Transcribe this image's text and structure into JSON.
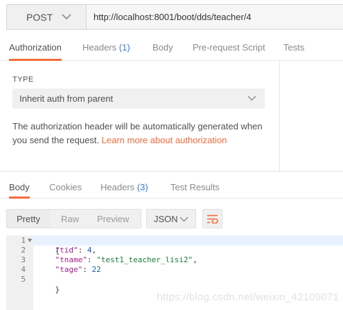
{
  "request": {
    "method": "POST",
    "url": "http://localhost:8001/boot/dds/teacher/4"
  },
  "request_tabs": [
    {
      "label": "Authorization",
      "count": "",
      "active": true
    },
    {
      "label": "Headers",
      "count": "(1)",
      "active": false
    },
    {
      "label": "Body",
      "count": "",
      "active": false
    },
    {
      "label": "Pre-request Script",
      "count": "",
      "active": false
    },
    {
      "label": "Tests",
      "count": "",
      "active": false
    }
  ],
  "auth": {
    "type_label": "TYPE",
    "type_value": "Inherit auth from parent",
    "description": "The authorization header will be automatically generated when you send the request. ",
    "link_text": "Learn more about authorization"
  },
  "response_tabs": [
    {
      "label": "Body",
      "count": "",
      "active": true
    },
    {
      "label": "Cookies",
      "count": "",
      "active": false
    },
    {
      "label": "Headers",
      "count": "(3)",
      "active": false
    },
    {
      "label": "Test Results",
      "count": "",
      "active": false
    }
  ],
  "response_toolbar": {
    "view_modes": [
      "Pretty",
      "Raw",
      "Preview"
    ],
    "active_view": "Pretty",
    "format": "JSON",
    "wrap_icon": "wrap-lines-icon"
  },
  "response_body": {
    "line_numbers": [
      "1",
      "2",
      "3",
      "4",
      "5"
    ],
    "open_brace": "{",
    "close_brace": "}",
    "fields": [
      {
        "key": "\"tid\"",
        "value": "4",
        "value_type": "number",
        "trailing": ","
      },
      {
        "key": "\"tname\"",
        "value": "\"test1_teacher_lisi2\"",
        "value_type": "string",
        "trailing": ","
      },
      {
        "key": "\"tage\"",
        "value": "22",
        "value_type": "number",
        "trailing": ""
      }
    ]
  },
  "watermark": "https://blog.csdn.net/weixin_42109071",
  "colors": {
    "accent": "#f26b3a",
    "count_blue": "#3a7bd5",
    "json_key": "#a11d8f",
    "json_string": "#1a7b3a",
    "json_number": "#1a5bb0"
  }
}
